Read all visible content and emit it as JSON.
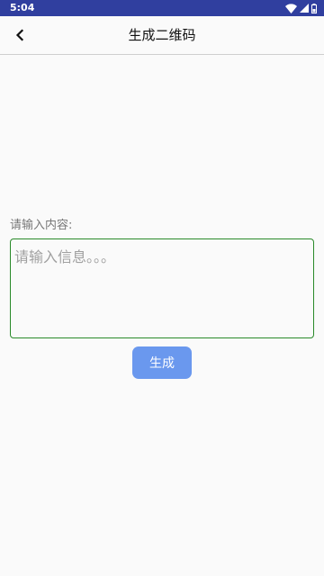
{
  "status_bar": {
    "time": "5:04",
    "icons": [
      "wifi-icon",
      "cell-signal-icon",
      "battery-icon"
    ],
    "background": "#303f9f"
  },
  "toolbar": {
    "back_icon": "chevron-left-icon",
    "title": "生成二维码"
  },
  "form": {
    "label": "请输入内容:",
    "input_value": "",
    "input_placeholder": "请输入信息。。。",
    "input_border_color": "#2a8a2a",
    "generate_label": "生成",
    "generate_color": "#6a98ee"
  }
}
